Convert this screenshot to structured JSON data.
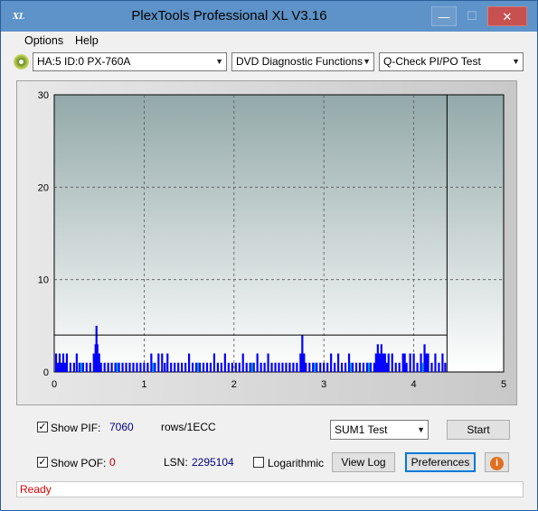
{
  "window": {
    "title": "PlexTools Professional XL V3.16",
    "app_icon_text": "XL",
    "min_glyph": "—",
    "max_glyph": "☐",
    "close_glyph": "✕"
  },
  "menu": [
    {
      "label": "Options",
      "key": "O"
    },
    {
      "label": "Help",
      "key": "H"
    }
  ],
  "toolbar": {
    "drive": "HA:5 ID:0  PX-760A",
    "function": "DVD Diagnostic Functions",
    "test": "Q-Check PI/PO Test",
    "arrow": "▼"
  },
  "chart_data": {
    "type": "bar",
    "xlim": [
      0,
      5
    ],
    "ylim": [
      0,
      30
    ],
    "x_ticks": [
      "0",
      "1",
      "2",
      "3",
      "4",
      "5"
    ],
    "y_ticks": [
      "0",
      "10",
      "20",
      "30"
    ],
    "grid": true,
    "threshold": 4,
    "data_end": 4.37,
    "series": [
      {
        "color": "#0000ff",
        "note": "PI errors",
        "points": [
          [
            0.02,
            2
          ],
          [
            0.04,
            1
          ],
          [
            0.06,
            2
          ],
          [
            0.08,
            1
          ],
          [
            0.1,
            2
          ],
          [
            0.12,
            1
          ],
          [
            0.14,
            2
          ],
          [
            0.18,
            1
          ],
          [
            0.22,
            1
          ],
          [
            0.25,
            2
          ],
          [
            0.28,
            1
          ],
          [
            0.32,
            1
          ],
          [
            0.36,
            1
          ],
          [
            0.4,
            1
          ],
          [
            0.44,
            2
          ],
          [
            0.46,
            3
          ],
          [
            0.47,
            5
          ],
          [
            0.48,
            3
          ],
          [
            0.5,
            2
          ],
          [
            0.52,
            1
          ],
          [
            0.56,
            1
          ],
          [
            0.6,
            1
          ],
          [
            0.64,
            1
          ],
          [
            0.68,
            1
          ],
          [
            0.72,
            1
          ],
          [
            0.76,
            1
          ],
          [
            0.8,
            1
          ],
          [
            0.84,
            1
          ],
          [
            0.88,
            1
          ],
          [
            0.92,
            1
          ],
          [
            0.96,
            1
          ],
          [
            1.0,
            1
          ],
          [
            1.04,
            1
          ],
          [
            1.08,
            2
          ],
          [
            1.12,
            1
          ],
          [
            1.16,
            2
          ],
          [
            1.2,
            2
          ],
          [
            1.23,
            1
          ],
          [
            1.26,
            2
          ],
          [
            1.3,
            1
          ],
          [
            1.34,
            1
          ],
          [
            1.38,
            1
          ],
          [
            1.42,
            1
          ],
          [
            1.46,
            1
          ],
          [
            1.5,
            2
          ],
          [
            1.54,
            1
          ],
          [
            1.58,
            1
          ],
          [
            1.62,
            1
          ],
          [
            1.66,
            1
          ],
          [
            1.7,
            1
          ],
          [
            1.74,
            1
          ],
          [
            1.78,
            2
          ],
          [
            1.82,
            1
          ],
          [
            1.86,
            1
          ],
          [
            1.9,
            2
          ],
          [
            1.94,
            1
          ],
          [
            1.98,
            1
          ],
          [
            2.02,
            1
          ],
          [
            2.06,
            1
          ],
          [
            2.1,
            2
          ],
          [
            2.14,
            1
          ],
          [
            2.18,
            1
          ],
          [
            2.22,
            1
          ],
          [
            2.26,
            2
          ],
          [
            2.3,
            1
          ],
          [
            2.34,
            1
          ],
          [
            2.38,
            2
          ],
          [
            2.42,
            1
          ],
          [
            2.46,
            1
          ],
          [
            2.5,
            1
          ],
          [
            2.54,
            1
          ],
          [
            2.58,
            1
          ],
          [
            2.62,
            1
          ],
          [
            2.66,
            1
          ],
          [
            2.7,
            1
          ],
          [
            2.74,
            2
          ],
          [
            2.76,
            4
          ],
          [
            2.78,
            2
          ],
          [
            2.8,
            1
          ],
          [
            2.84,
            1
          ],
          [
            2.88,
            1
          ],
          [
            2.92,
            1
          ],
          [
            2.96,
            1
          ],
          [
            3.0,
            1
          ],
          [
            3.04,
            1
          ],
          [
            3.08,
            2
          ],
          [
            3.12,
            1
          ],
          [
            3.16,
            2
          ],
          [
            3.2,
            1
          ],
          [
            3.24,
            1
          ],
          [
            3.28,
            2
          ],
          [
            3.32,
            1
          ],
          [
            3.36,
            1
          ],
          [
            3.4,
            1
          ],
          [
            3.44,
            1
          ],
          [
            3.48,
            1
          ],
          [
            3.52,
            1
          ],
          [
            3.56,
            1
          ],
          [
            3.58,
            2
          ],
          [
            3.6,
            3
          ],
          [
            3.62,
            2
          ],
          [
            3.64,
            3
          ],
          [
            3.66,
            2
          ],
          [
            3.68,
            2
          ],
          [
            3.7,
            1
          ],
          [
            3.72,
            2
          ],
          [
            3.76,
            2
          ],
          [
            3.8,
            1
          ],
          [
            3.84,
            1
          ],
          [
            3.88,
            2
          ],
          [
            3.9,
            2
          ],
          [
            3.92,
            1
          ],
          [
            3.96,
            2
          ],
          [
            4.0,
            2
          ],
          [
            4.04,
            1
          ],
          [
            4.08,
            2
          ],
          [
            4.12,
            3
          ],
          [
            4.14,
            2
          ],
          [
            4.16,
            2
          ],
          [
            4.2,
            1
          ],
          [
            4.24,
            2
          ],
          [
            4.28,
            1
          ],
          [
            4.32,
            2
          ],
          [
            4.35,
            1
          ]
        ]
      },
      {
        "color": "#00a0e0",
        "note": "baseline",
        "points": [
          [
            0.3,
            1
          ],
          [
            0.7,
            1
          ],
          [
            1.1,
            1
          ],
          [
            1.6,
            1
          ],
          [
            2.2,
            1
          ],
          [
            2.9,
            1
          ],
          [
            3.3,
            1
          ],
          [
            3.5,
            1
          ],
          [
            4.1,
            1
          ]
        ]
      }
    ]
  },
  "controls": {
    "show_pif_label": "Show PIF:",
    "pif_value": "7060",
    "units": "rows/1ECC",
    "show_pof_label": "Show POF:",
    "pof_value": "0",
    "lsn_label": "LSN:",
    "lsn_value": "2295104",
    "log_label": "Logarithmic",
    "sum_select": "SUM1 Test",
    "start": "Start",
    "view_log": "View Log",
    "preferences": "Preferences",
    "info_icon": "i",
    "check": "✓"
  },
  "status": "Ready"
}
